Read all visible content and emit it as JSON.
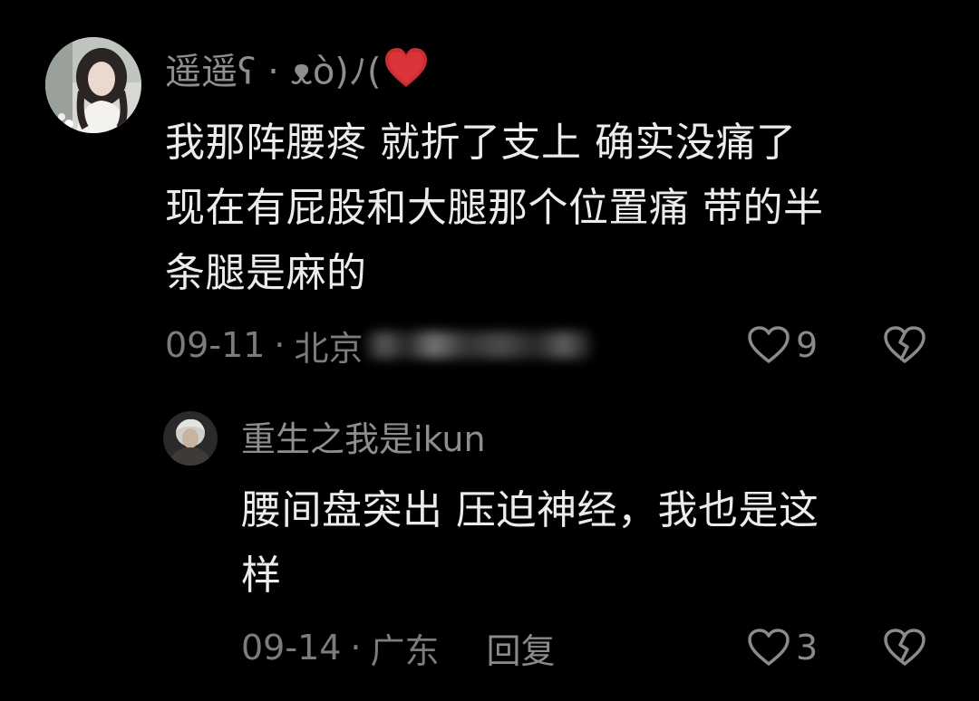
{
  "comments": [
    {
      "username": "遥遥ʕ · ᴥò)ﾉ(",
      "text_lines": [
        "我那阵腰疼 就折了支上 确实没痛了",
        "现在有屁股和大腿那个位置痛 带的半",
        "条腿是麻的"
      ],
      "date": "09-11",
      "location": "北京",
      "likes": "9"
    }
  ],
  "replies": [
    {
      "username": "重生之我是ikun",
      "text_lines": [
        "腰间盘突出 压迫神经，我也是这",
        "样"
      ],
      "date": "09-14",
      "location": "广东",
      "reply_label": "回复",
      "likes": "3"
    }
  ],
  "colors": {
    "background": "#000000",
    "username": "#8e8e8e",
    "text": "#ececec",
    "meta": "#7c7c7c",
    "heart_emoji": "#d9343a"
  },
  "icons": [
    "heart-emoji-icon",
    "like-heart-icon",
    "dislike-broken-heart-icon"
  ]
}
